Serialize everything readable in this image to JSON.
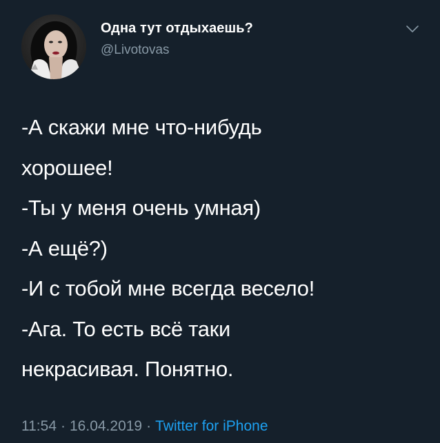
{
  "tweet": {
    "author": {
      "display_name": "Одна тут отдыхаешь?",
      "handle": "@Livotovas",
      "avatar_icon": "user-avatar"
    },
    "menu_icon": "chevron-down-icon",
    "lines": [
      "-А скажи мне что-нибудь",
      "хорошее!",
      "-Ты у меня очень умная)",
      "-А ещё?)",
      "-И с тобой мне всегда весело!",
      "-Ага. То есть всё таки",
      "некрасивая. Понятно."
    ],
    "time": "11:54",
    "separator": "·",
    "date": "16.04.2019",
    "source": "Twitter for iPhone"
  },
  "colors": {
    "background": "#15202b",
    "primary_text": "#ffffff",
    "secondary_text": "#8899a6",
    "link": "#1da1f2"
  }
}
